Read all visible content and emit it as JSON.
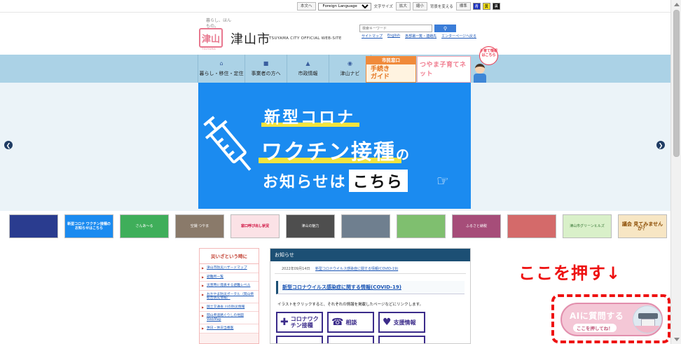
{
  "utility": {
    "text_only": "本文へ",
    "language_select": "Foreign Language",
    "font_size_label": "文字サイズ",
    "font_larger": "拡大",
    "font_smaller": "縮小",
    "bg_color_label": "背景を変える",
    "bg_standard": "標準",
    "bg_blue": "青",
    "bg_yellow": "黄",
    "bg_black": "黒",
    "colors": {
      "blue": "#1a2fbf",
      "yellow": "#f7e31a",
      "black": "#111111"
    }
  },
  "logo": {
    "tagline": "暮らし、ほんもの。",
    "stamp": "津山",
    "stamp_caption": "TSUYAMA",
    "city_name": "津山市",
    "site_name": "TSUYAMA CITY OFFICIAL WEB-SITE"
  },
  "search": {
    "placeholder": "検索キーワード",
    "button_icon": "search-icon"
  },
  "quick_links": [
    "サイトマップ",
    "English",
    "各部署一覧・連絡先",
    "エンターページへ戻る"
  ],
  "nav": {
    "tabs": [
      {
        "label": "暮らし・移住・定住",
        "icon": "home-icon"
      },
      {
        "label": "事業者の方へ",
        "icon": "briefcase-icon"
      },
      {
        "label": "市政情報",
        "icon": "building-icon"
      },
      {
        "label": "津山ナビ",
        "icon": "map-pin-icon"
      }
    ],
    "shimin_banner": {
      "top": "市民窓口",
      "main_line1": "手続き",
      "main_line2": "ガイド"
    },
    "kosodate_banner": {
      "text": "つやま子育てネット"
    },
    "kosodate_bubble": "子育て情報はこちら"
  },
  "hero": {
    "line1": "新型コロナ",
    "line2_main": "ワクチン接種",
    "line2_particle": "の",
    "line3_pre": "お知らせは",
    "line3_box": "こちら",
    "bg_color": "#1b8bf0",
    "highlight_color": "#f3e43e"
  },
  "carousel": {
    "prev_icon": "chevron-left-icon",
    "next_icon": "chevron-right-icon"
  },
  "thumbs": [
    {
      "text": "",
      "bg": "#2a3c8f",
      "fg": "#fff"
    },
    {
      "text": "新型コロナ ワクチン接種のお知らせはこちら",
      "bg": "#1b8bf0",
      "fg": "#fff"
    },
    {
      "text": "さんあ～る",
      "bg": "#3fae5a",
      "fg": "#fff"
    },
    {
      "text": "空撮 つやま",
      "bg": "#8a7a6a",
      "fg": "#fff"
    },
    {
      "text": "窓口呼び出し状況",
      "bg": "#fbe2e6",
      "fg": "#c03"
    },
    {
      "text": "津山の魅力",
      "bg": "#4e4e4e",
      "fg": "#fff"
    },
    {
      "text": "",
      "bg": "#6f7f8f",
      "fg": "#fff"
    },
    {
      "text": "",
      "bg": "#7fbf6f",
      "fg": "#fff"
    },
    {
      "text": "ふるさと納税",
      "bg": "#a64d79",
      "fg": "#fff"
    },
    {
      "text": "",
      "bg": "#d46a6a",
      "fg": "#fff"
    },
    {
      "text": "津山市グリーンヒルズ",
      "bg": "#d9f0c9",
      "fg": "#2b6e2b"
    },
    {
      "text": "議会 見てみませんか？",
      "bg": "#f7e6c4",
      "fg": "#8a4a00"
    }
  ],
  "emergency": {
    "heading": "災いざという時に",
    "items": [
      "津山市防災ハザードマップ",
      "避難所一覧",
      "災害時に発表する避難レベル",
      "おかやま防災ポータル（岡山県総合防災情報）",
      "国土交通省 川の防災情報",
      "岡山県道路ぐりしの地図WebMap",
      "休日・休日当番医"
    ]
  },
  "news": {
    "heading": "お知らせ",
    "items": [
      {
        "date": "2022年09月14日",
        "title": "新型コロナウイルス感染症に関する情報(COVID-19)"
      }
    ],
    "covid_title": "新型コロナウイルス感染症に関する情報(COVID-19)",
    "desc": "イラストをクリックすると、それぞれの情報を掲載したページなどにリンクします。",
    "buttons": [
      {
        "label": "コロナワクチン接種",
        "icon": "syringe-icon"
      },
      {
        "label": "相談",
        "icon": "phone-icon"
      },
      {
        "label": "支援情報",
        "icon": "support-hands-icon"
      }
    ]
  },
  "annotation": {
    "callout": "ここを押す↓",
    "ai_title": "AIに質問する",
    "ai_sub": "ここを押してね！",
    "callout_color": "#ee1111"
  }
}
